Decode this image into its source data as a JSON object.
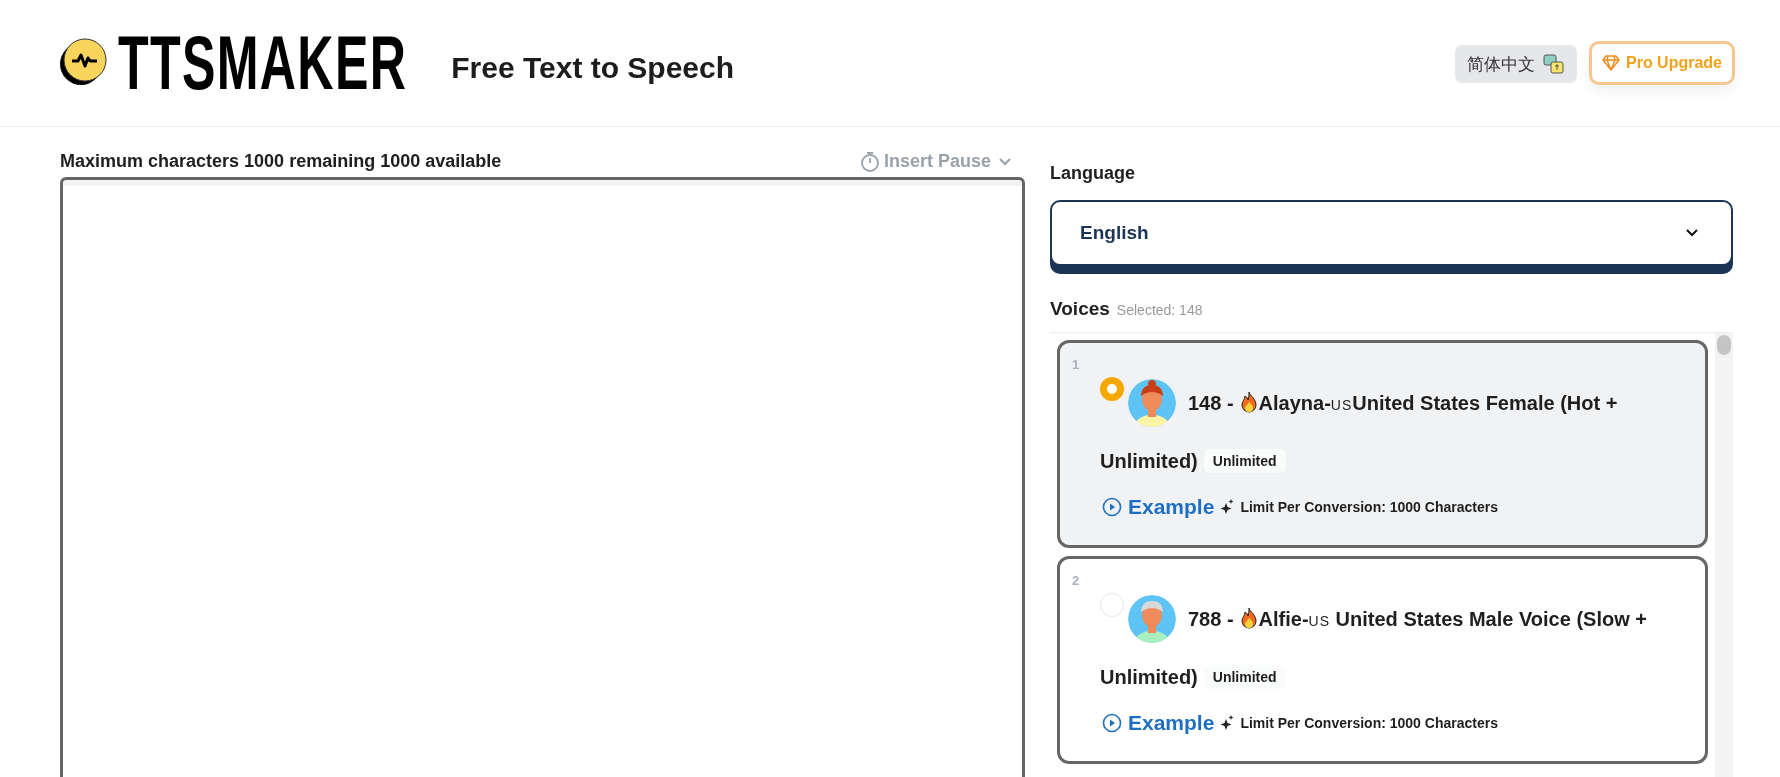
{
  "header": {
    "logo": "TTSMAKER",
    "tagline": "Free Text to Speech",
    "language_button": "简体中文",
    "upgrade_button": "Pro Upgrade"
  },
  "editor": {
    "limit_text": "Maximum characters 1000 remaining 1000 available",
    "insert_pause": "Insert Pause"
  },
  "language": {
    "label": "Language",
    "selected": "English"
  },
  "voices": {
    "label": "Voices",
    "selected_count": "Selected: 148",
    "items": [
      {
        "index": "1",
        "selected": true,
        "kind": "woman",
        "id": "148 -",
        "name": "Alayna-",
        "flag": "US",
        "description": "United States Female (Hot +",
        "description_wrap": "Unlimited)",
        "badge": "Unlimited",
        "example": "Example",
        "limit": "Limit Per Conversion: 1000 Characters"
      },
      {
        "index": "2",
        "selected": false,
        "kind": "man",
        "id": "788 -",
        "name": "Alfie-",
        "flag": "US",
        "description": " United States Male Voice (Slow +",
        "description_wrap": "Unlimited)",
        "badge": "Unlimited",
        "example": "Example",
        "limit": "Limit Per Conversion: 1000 Characters"
      }
    ]
  }
}
